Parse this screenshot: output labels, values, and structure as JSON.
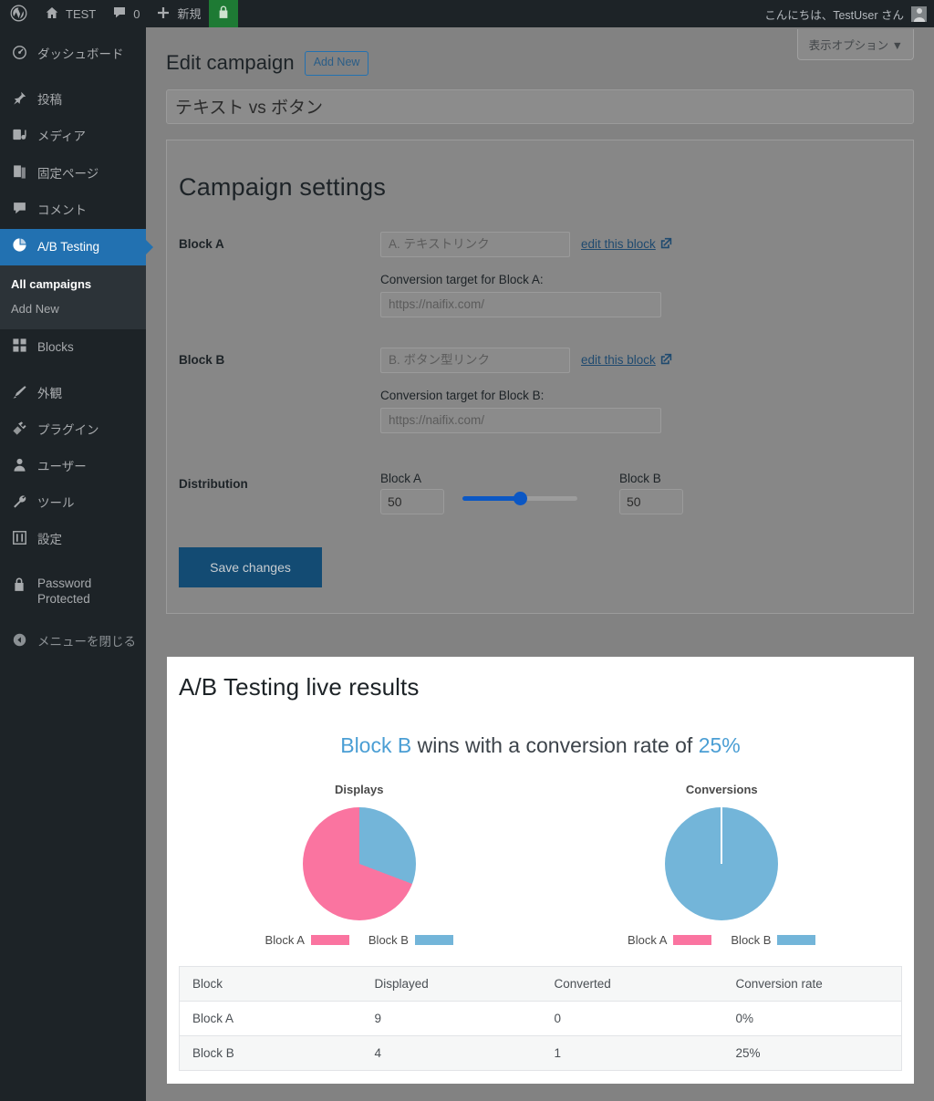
{
  "adminbar": {
    "logo_icon": "wordpress-logo-icon",
    "site_name": "TEST",
    "home_icon": "home-icon",
    "comments_icon": "comment-bubble-icon",
    "comments_count": "0",
    "new_icon": "plus-icon",
    "new_label": "新規",
    "lock_icon": "lock-icon",
    "greeting": "こんにちは、TestUser さん",
    "avatar_icon": "avatar-icon"
  },
  "sidebar": {
    "items": [
      {
        "label": "ダッシュボード",
        "icon": "dashboard-icon",
        "active": false
      },
      {
        "label": "投稿",
        "icon": "pin-icon",
        "active": false
      },
      {
        "label": "メディア",
        "icon": "media-icon",
        "active": false
      },
      {
        "label": "固定ページ",
        "icon": "pages-icon",
        "active": false
      },
      {
        "label": "コメント",
        "icon": "comment-bubble-icon",
        "active": false
      },
      {
        "label": "A/B Testing",
        "icon": "pie-chart-icon",
        "active": true
      },
      {
        "label": "Blocks",
        "icon": "blocks-grid-icon",
        "active": false
      },
      {
        "label": "外観",
        "icon": "appearance-brush-icon",
        "active": false
      },
      {
        "label": "プラグイン",
        "icon": "plugin-icon",
        "active": false
      },
      {
        "label": "ユーザー",
        "icon": "user-icon",
        "active": false
      },
      {
        "label": "ツール",
        "icon": "wrench-icon",
        "active": false
      },
      {
        "label": "設定",
        "icon": "settings-sliders-icon",
        "active": false
      },
      {
        "label": "Password Protected",
        "icon": "padlock-icon",
        "active": false
      },
      {
        "label": "メニューを閉じる",
        "icon": "collapse-arrow-icon",
        "active": false
      }
    ],
    "submenu": [
      {
        "label": "All campaigns",
        "current": true
      },
      {
        "label": "Add New",
        "current": false
      }
    ]
  },
  "header": {
    "screen_options_label": "表示オプション",
    "screen_options_caret": "▼",
    "page_title": "Edit campaign",
    "add_new_label": "Add New",
    "campaign_title_value": "テキスト vs ボタン"
  },
  "settings": {
    "heading": "Campaign settings",
    "block_a": {
      "label": "Block A",
      "block_value": "A. テキストリンク",
      "edit_link": "edit this block",
      "edit_link_icon": "external-link-icon",
      "target_label": "Conversion target for Block A:",
      "target_value": "https://naifix.com/"
    },
    "block_b": {
      "label": "Block B",
      "block_value": "B. ボタン型リンク",
      "edit_link": "edit this block",
      "edit_link_icon": "external-link-icon",
      "target_label": "Conversion target for Block B:",
      "target_value": "https://naifix.com/"
    },
    "distribution": {
      "label": "Distribution",
      "a_caption": "Block A",
      "a_value": "50",
      "b_caption": "Block B",
      "b_value": "50",
      "slider_percent": 50
    },
    "save_label": "Save changes"
  },
  "results": {
    "heading": "A/B Testing live results",
    "winner_prefix": "Block B",
    "winner_middle": " wins with a conversion rate of ",
    "winner_rate": "25%",
    "legend_a": "Block A",
    "legend_b": "Block B",
    "colors": {
      "block_a": "#fa74a0",
      "block_b": "#73b5d9",
      "accent_blue": "#4a9ed4",
      "admin_blue": "#2271b1",
      "save_button": "#134b73"
    },
    "table": {
      "columns": [
        "Block",
        "Displayed",
        "Converted",
        "Conversion rate"
      ],
      "rows": [
        {
          "block": "Block A",
          "displayed": "9",
          "converted": "0",
          "rate": "0%"
        },
        {
          "block": "Block B",
          "displayed": "4",
          "converted": "1",
          "rate": "25%"
        }
      ]
    }
  },
  "chart_data": [
    {
      "type": "pie",
      "title": "Displays",
      "categories": [
        "Block A",
        "Block B"
      ],
      "values": [
        9,
        4
      ],
      "percentages": [
        69.2,
        30.8
      ],
      "colors": [
        "#fa74a0",
        "#73b5d9"
      ],
      "legend_position": "bottom"
    },
    {
      "type": "pie",
      "title": "Conversions",
      "categories": [
        "Block A",
        "Block B"
      ],
      "values": [
        0,
        1
      ],
      "percentages": [
        0,
        100
      ],
      "colors": [
        "#fa74a0",
        "#73b5d9"
      ],
      "legend_position": "bottom"
    }
  ]
}
